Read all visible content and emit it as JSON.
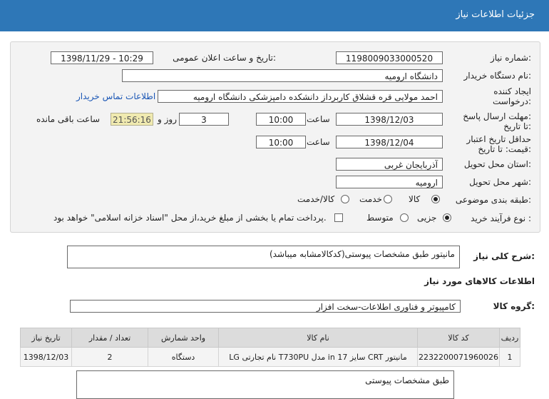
{
  "header": {
    "title": "جزئیات اطلاعات نیاز"
  },
  "form": {
    "need_number_label": "شماره نیاز:",
    "need_number": "1198009033000520",
    "announce_label": "تاریخ و ساعت اعلان عمومی:",
    "announce_value": "1398/11/29 - 10:29",
    "buyer_label": "نام دستگاه خریدار:",
    "buyer_value": "دانشگاه ارومیه",
    "creator_label_1": "ایجاد کننده",
    "creator_label_2": "درخواست:",
    "creator_value": "احمد مولایی قره قشلاق کاربرداز دانشکده دامپزشکی دانشگاه ارومیه",
    "contact_link": "اطلاعات تماس خریدار",
    "reply_label_1": "مهلت ارسال پاسخ:",
    "reply_label_2": "تا تاریخ:",
    "reply_date": "1398/12/03",
    "time_label": "ساعت",
    "reply_time": "10:00",
    "days_value": "3",
    "days_label": "روز و",
    "remaining_timer": "21:56:16",
    "remaining_label": "ساعت باقی مانده",
    "validity_label_1": "حداقل تاریخ اعتبار",
    "validity_label_2": "قیمت: تا تاریخ:",
    "validity_date": "1398/12/04",
    "validity_time": "10:00",
    "province_label": "استان محل تحویل:",
    "province_value": "آذربایجان غربی",
    "city_label": "شهر محل تحویل:",
    "city_value": "ارومیه",
    "category_label": "طبقه بندی موضوعی:",
    "category_options": [
      "کالا",
      "خدمت",
      "کالا/خدمت"
    ],
    "process_label": "نوع فرآیند خرید :",
    "process_options": [
      "جزیی",
      "متوسط"
    ],
    "treasury_text": "پرداخت تمام یا بخشی از مبلغ خرید،از محل \"اسناد خزانه اسلامی\" خواهد بود."
  },
  "summary": {
    "label": "شرح کلی نیاز:",
    "value": "مانیتور طبق مشخصات پیوستی(کدکالامشابه میباشد)"
  },
  "goods": {
    "section_title": "اطلاعات کالاهای مورد نیاز",
    "group_label": "گروه کالا:",
    "group_value": "کامپیوتر و فناوری اطلاعات-سخت افزار"
  },
  "table": {
    "headers": [
      "ردیف",
      "کد کالا",
      "نام کالا",
      "واحد شمارش",
      "تعداد / مقدار",
      "تاریخ نیاز"
    ],
    "rows": [
      [
        "1",
        "2232200071960026",
        "مانیتور CRT سایز 17 in مدل T730PU نام تجارتی LG",
        "دستگاه",
        "2",
        "1398/12/03"
      ]
    ]
  },
  "notes": {
    "value": "طبق مشخصات پیوستی"
  }
}
